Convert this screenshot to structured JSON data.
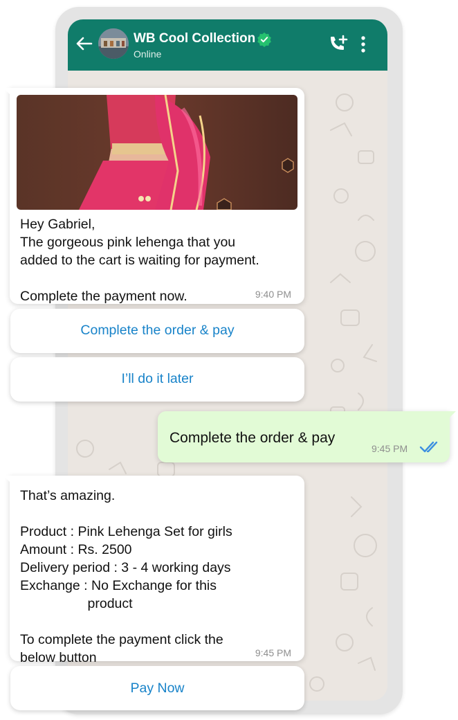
{
  "header": {
    "contact_name": "WB Cool Collection",
    "status": "Online",
    "bg_color": "#107c6a",
    "icons": [
      "back-arrow-icon",
      "avatar",
      "verified-badge-icon",
      "add-call-icon",
      "more-vert-icon"
    ]
  },
  "messages": {
    "first": {
      "text": "Hey Gabriel,\nThe gorgeous pink lehenga that you\nadded to the cart is waiting for payment.\n\nComplete the payment now.",
      "time": "9:40 PM",
      "buttons": [
        "Complete the order & pay",
        "I’ll do it later"
      ]
    },
    "reply": {
      "text": "Complete the order & pay",
      "time": "9:45 PM",
      "bubble_color": "#e2fbd6",
      "read_tick_color": "#3d8fe0"
    },
    "second": {
      "text": "That’s amazing.\n\nProduct : Pink Lehenga Set for girls\nAmount : Rs. 2500\nDelivery period : 3 - 4 working days\nExchange : No Exchange for this\n                  product\n\nTo complete the payment click the\nbelow button",
      "time": "9:45 PM",
      "button": "Pay Now"
    }
  },
  "colors": {
    "link_blue": "#1883c9",
    "chat_bg": "#ebe6e1",
    "verified_green": "#25c16f"
  }
}
